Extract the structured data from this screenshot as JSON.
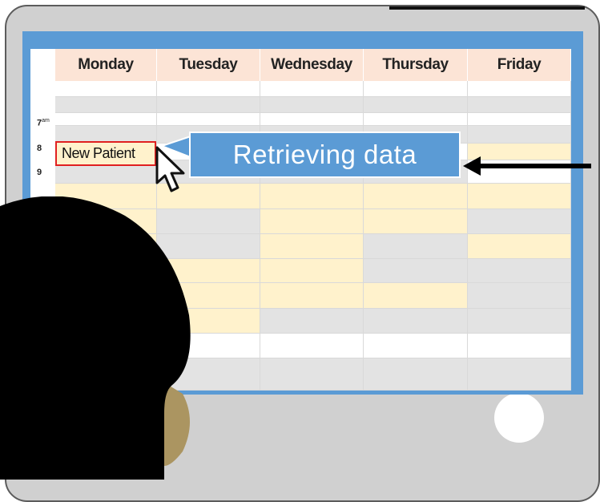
{
  "calendar": {
    "days": [
      "Monday",
      "Tuesday",
      "Wednesday",
      "Thursday",
      "Friday"
    ],
    "times": [
      {
        "hour": "7",
        "suffix": "am"
      },
      {
        "hour": "8",
        "suffix": ""
      },
      {
        "hour": "9",
        "suffix": ""
      }
    ],
    "event": {
      "label": "New Patient",
      "day": "Monday",
      "hour": "8"
    }
  },
  "callout": {
    "text": "Retrieving data"
  },
  "colors": {
    "screen_frame": "#5b9bd5",
    "header_fill": "#fce4d6",
    "booked_slot": "#fff2cc",
    "unavailable_slot": "#e3e3e3",
    "event_border": "#e02020"
  },
  "icons": {
    "cursor": "mouse-pointer-icon",
    "arrow": "left-arrow-icon"
  }
}
